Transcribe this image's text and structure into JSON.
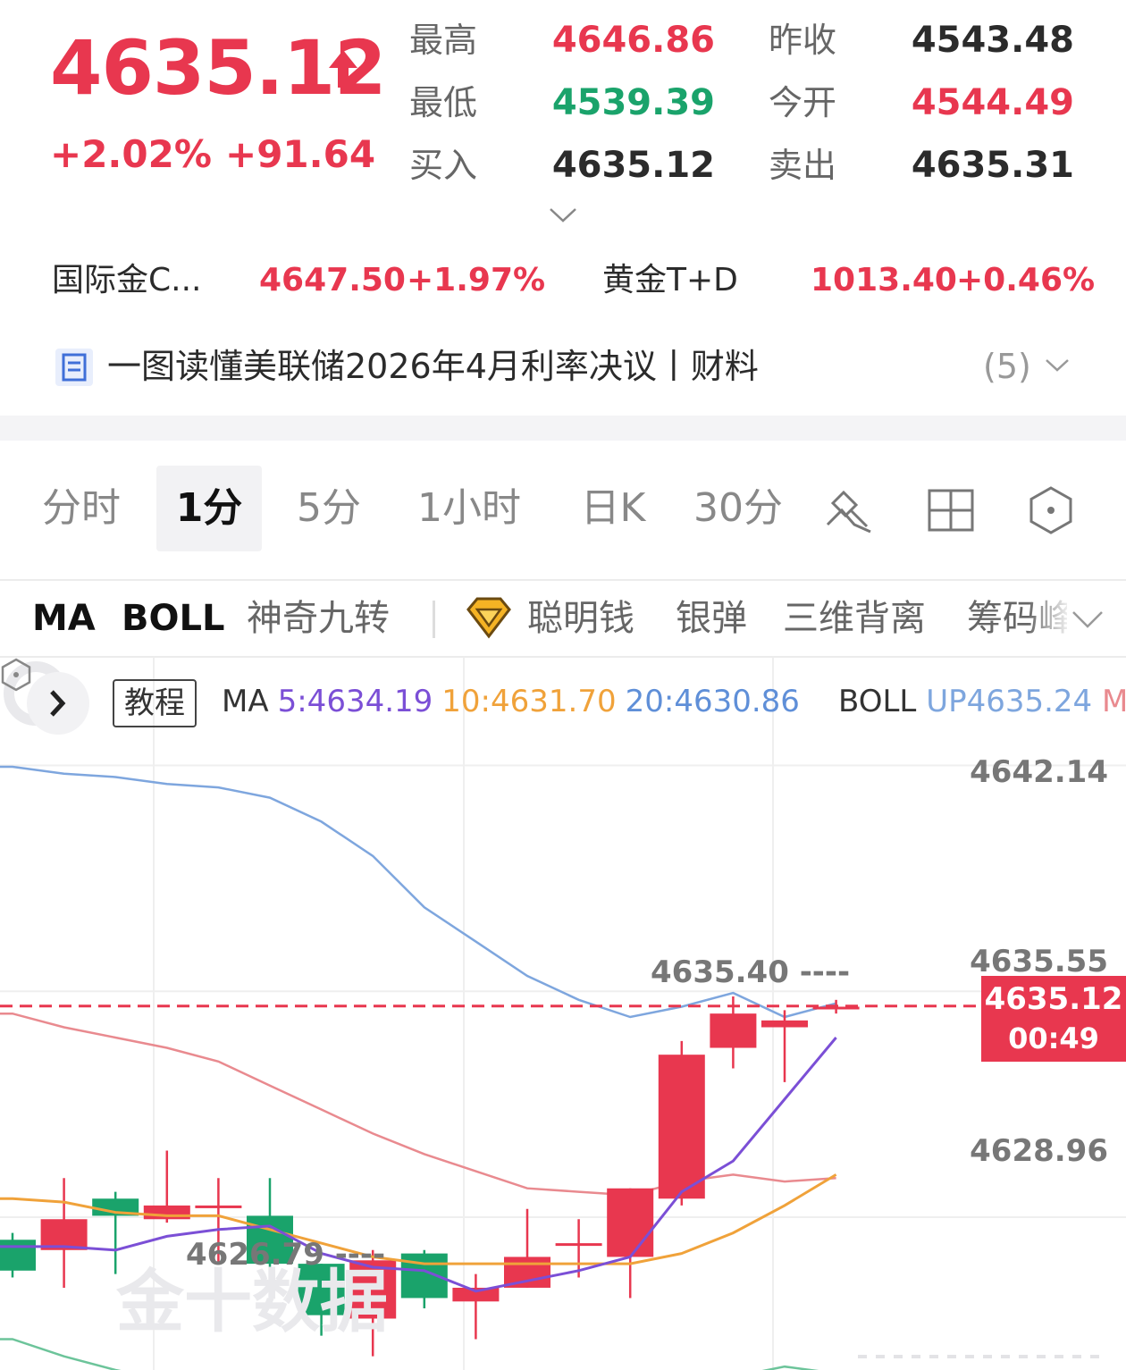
{
  "quote": {
    "price": "4635.12",
    "change_pct": "+2.02%",
    "change_abs": "+91.64",
    "stats": [
      {
        "label": "最高",
        "value": "4646.86",
        "color": "red"
      },
      {
        "label": "昨收",
        "value": "4543.48",
        "color": "dark"
      },
      {
        "label": "最低",
        "value": "4539.39",
        "color": "green"
      },
      {
        "label": "今开",
        "value": "4544.49",
        "color": "red"
      },
      {
        "label": "买入",
        "value": "4635.12",
        "color": "dark"
      },
      {
        "label": "卖出",
        "value": "4635.31",
        "color": "dark"
      }
    ]
  },
  "related": [
    {
      "name": "国际金C...",
      "price": "4647.50",
      "change": "+1.97%"
    },
    {
      "name": "黄金T+D",
      "price": "1013.40",
      "change": "+0.46%"
    }
  ],
  "news": {
    "title": "一图读懂美联储2026年4月利率决议丨财料",
    "count": "(5)"
  },
  "tabs": [
    "分时",
    "1分",
    "5分",
    "1小时",
    "日K",
    "30分"
  ],
  "active_tab": "1分",
  "indicators": [
    "MA",
    "BOLL",
    "神奇九转",
    "聪明钱",
    "银弹",
    "三维背离",
    "筹码峰"
  ],
  "legend": {
    "tutorial": "教程",
    "ma_label": "MA",
    "ma5": "5:4634.19",
    "ma10": "10:4631.70",
    "ma20": "20:4630.86",
    "boll_label": "BOLL",
    "boll_up": "UP4635.24",
    "boll_mid": "MID"
  },
  "axis": {
    "top": "4642.14",
    "mid": "4635.55",
    "low": "4628.96"
  },
  "current_tag": {
    "price": "4635.12",
    "countdown": "00:49"
  },
  "extremes": {
    "high": "4635.40 ----",
    "low": "4626.79 ----"
  },
  "watermark": "金十数据",
  "colors": {
    "up": "#e8374f",
    "down": "#1aa36b",
    "ma5": "#7b4fd6",
    "ma10": "#f0a23a",
    "ma20": "#5f8fd8",
    "boll_up": "#7ea6de",
    "boll_mid": "#e98a8f",
    "boll_low": "#6cc49a"
  },
  "chart_data": {
    "type": "candlestick",
    "y_range": [
      4624.5,
      4644.5
    ],
    "candles": [
      {
        "o": 4628.3,
        "c": 4627.4,
        "h": 4628.5,
        "l": 4627.2
      },
      {
        "o": 4628.0,
        "c": 4628.9,
        "h": 4630.1,
        "l": 4626.9
      },
      {
        "o": 4629.5,
        "c": 4629.0,
        "h": 4629.7,
        "l": 4627.3
      },
      {
        "o": 4628.9,
        "c": 4629.3,
        "h": 4630.9,
        "l": 4628.8
      },
      {
        "o": 4629.3,
        "c": 4629.3,
        "h": 4630.1,
        "l": 4627.6
      },
      {
        "o": 4629.0,
        "c": 4627.6,
        "h": 4630.1,
        "l": 4627.3
      },
      {
        "o": 4627.6,
        "c": 4626.1,
        "h": 4627.6,
        "l": 4625.5
      },
      {
        "o": 4626.0,
        "c": 4627.7,
        "h": 4628.0,
        "l": 4624.9
      },
      {
        "o": 4627.9,
        "c": 4626.6,
        "h": 4628.0,
        "l": 4626.3
      },
      {
        "o": 4626.5,
        "c": 4626.9,
        "h": 4627.3,
        "l": 4625.4
      },
      {
        "o": 4626.9,
        "c": 4627.8,
        "h": 4629.2,
        "l": 4626.9
      },
      {
        "o": 4628.2,
        "c": 4628.2,
        "h": 4628.9,
        "l": 4627.2
      },
      {
        "o": 4627.8,
        "c": 4629.8,
        "h": 4629.8,
        "l": 4626.6
      },
      {
        "o": 4629.5,
        "c": 4633.7,
        "h": 4634.1,
        "l": 4629.3
      },
      {
        "o": 4633.9,
        "c": 4634.9,
        "h": 4635.4,
        "l": 4633.3
      },
      {
        "o": 4634.5,
        "c": 4634.7,
        "h": 4635.0,
        "l": 4632.9
      },
      {
        "o": 4635.1,
        "c": 4635.1,
        "h": 4635.3,
        "l": 4634.9
      }
    ],
    "ma5": [
      4628.1,
      4628.1,
      4628.0,
      4628.4,
      4628.6,
      4628.7,
      4627.9,
      4627.5,
      4627.4,
      4626.8,
      4627.1,
      4627.4,
      4627.8,
      4629.7,
      4630.6,
      4632.4,
      4634.2
    ],
    "ma10": [
      4629.5,
      4629.4,
      4629.1,
      4629.0,
      4629.0,
      4628.6,
      4628.2,
      4627.8,
      4627.6,
      4627.6,
      4627.6,
      4627.6,
      4627.6,
      4627.9,
      4628.5,
      4629.3,
      4630.2
    ],
    "boll_up": [
      4642.1,
      4641.9,
      4641.8,
      4641.6,
      4641.5,
      4641.2,
      4640.5,
      4639.5,
      4638.0,
      4637.0,
      4636.0,
      4635.3,
      4634.8,
      4635.1,
      4635.5,
      4634.8,
      4635.2
    ],
    "boll_mid": [
      4634.9,
      4634.5,
      4634.2,
      4633.9,
      4633.5,
      4632.8,
      4632.1,
      4631.4,
      4630.8,
      4630.3,
      4629.8,
      4629.7,
      4629.6,
      4630.0,
      4630.2,
      4630.0,
      4630.1
    ],
    "boll_low": [
      4625.4,
      4624.9,
      4624.5,
      4624.2,
      4623.8,
      4623.4,
      4623.1,
      4622.9,
      4622.9,
      4623.3,
      4623.6,
      4623.9,
      4624.3,
      4624.1,
      4624.3,
      4624.6,
      4624.4
    ]
  }
}
